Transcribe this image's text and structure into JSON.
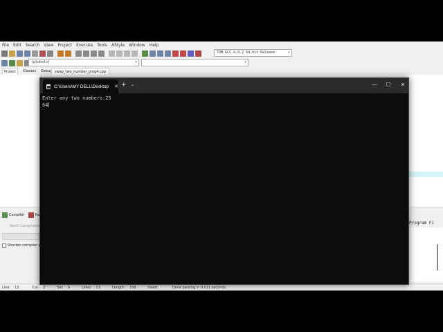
{
  "ide": {
    "menu": [
      "File",
      "Edit",
      "Search",
      "View",
      "Project",
      "Execute",
      "Tools",
      "AStyle",
      "Window",
      "Help"
    ],
    "compiler_select": "TDM-GCC 4.9.2 64-bit Release",
    "scope_select": "(globals)",
    "panel_tabs": [
      "Project",
      "Classes",
      "Debug"
    ],
    "editor_tab": "swap_two_number_prog4.cpp",
    "bottom": {
      "compiler_tab": "Compiler",
      "resources_tab": "Re",
      "abort_button": "Abort Compilation",
      "shorten_checkbox": "Shorten compiler p",
      "right_header": "Program Fi"
    },
    "status": {
      "line_label": "Line:",
      "line_value": "13",
      "col_label": "Col:",
      "col_value": "2",
      "sel_label": "Sel:",
      "sel_value": "0",
      "lines_label": "Lines:",
      "lines_value": "13",
      "length_label": "Length:",
      "length_value": "338",
      "mode": "Insert",
      "message": "Done parsing in 0.031 seconds"
    }
  },
  "terminal": {
    "tab_title": "C:\\Users\\MY DELL\\Desktop",
    "tab_close": "✕",
    "new_tab": "+",
    "dropdown": "⌄",
    "minimize": "—",
    "maximize": "☐",
    "close": "✕",
    "lines": [
      "Enter any two numbers:25",
      "64"
    ]
  }
}
